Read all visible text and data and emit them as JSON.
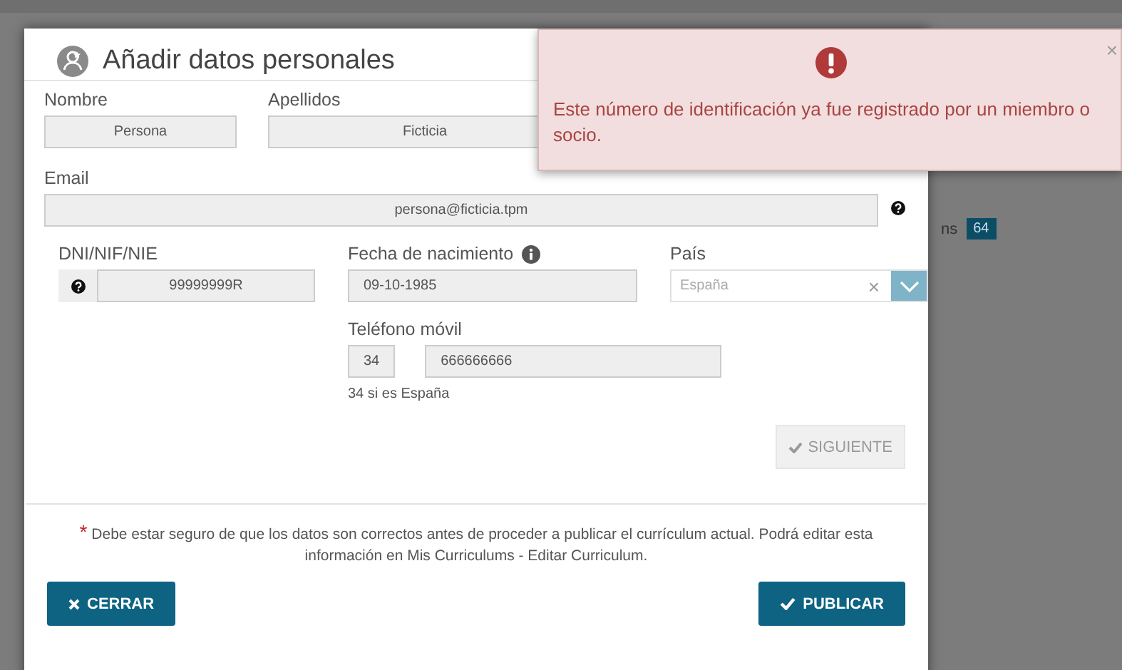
{
  "background": {
    "tab_label": "ns",
    "badge": "64"
  },
  "dialog": {
    "title": "Añadir datos personales",
    "fields": [
      {
        "label": "Nombre",
        "value": "Persona"
      },
      {
        "label": "Apellidos",
        "value": "Ficticia"
      },
      {
        "label": "Email",
        "value": "persona@ficticia.tpm"
      },
      {
        "label": "DNI/NIF/NIE",
        "value": "99999999R"
      },
      {
        "label": "Fecha de nacimiento",
        "value": "09-10-1985"
      },
      {
        "label": "País",
        "placeholder": "España",
        "clear": "×"
      },
      {
        "label": "Teléfono móvil",
        "prefix": "34",
        "value": "666666666",
        "hint": "34 si es España"
      }
    ],
    "next_button": {
      "label": "SIGUIENTE",
      "disabled": true
    },
    "note": {
      "mark": "*",
      "text": "Debe estar seguro de que los datos son correctos antes de proceder a publicar el currículum actual. Podrá editar esta información en Mis Curriculums - Editar Curriculum."
    },
    "buttons": [
      {
        "label": "CERRAR",
        "kind": "close"
      },
      {
        "label": "PUBLICAR",
        "kind": "confirm"
      }
    ]
  },
  "alert": {
    "message": "Este número de identificación ya fue registrado por un miembro o socio.",
    "close": "×"
  }
}
